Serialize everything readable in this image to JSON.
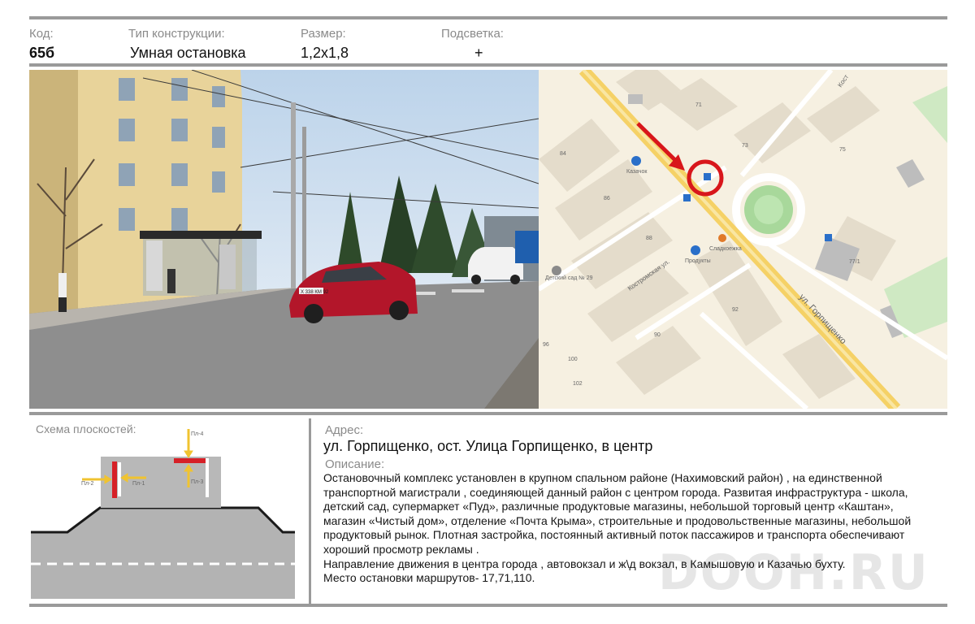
{
  "header": {
    "code_label": "Код:",
    "code_value": "65б",
    "type_label": "Тип конструкции:",
    "type_value": "Умная остановка",
    "size_label": "Размер:",
    "size_value": "1,2х1,8",
    "light_label": "Подсветка:",
    "light_value": "+"
  },
  "photo": {
    "plate": "Х 338 КМ 92"
  },
  "map": {
    "street_main": "ул. Горпищенко",
    "street_side": "Костромская ул.",
    "street_top": "Кост",
    "poi_kazachok": "Казачок",
    "poi_produkt": "Продукты",
    "poi_sladkoezhka": "Сладкоежка",
    "poi_kindergarten": "Детский сад № 29",
    "house_numbers": [
      "71",
      "73",
      "75",
      "84",
      "86",
      "88",
      "90",
      "92",
      "96",
      "100",
      "102",
      "77/1"
    ],
    "colors": {
      "marker": "#d8161b",
      "road": "#f5d166",
      "arrow": "#d8161b"
    }
  },
  "scheme": {
    "title": "Схема плоскостей:",
    "labels": [
      "Пл-1",
      "Пл-2",
      "Пл-3",
      "Пл-4"
    ]
  },
  "address": {
    "label": "Адрес:",
    "value": "ул. Горпищенко, ост. Улица Горпищенко, в центр"
  },
  "description": {
    "label": "Описание:",
    "lines": [
      "Остановочный комплекс установлен  в крупном спальном районе (Нахимовский район) , на единственной",
      "транспортной магистрали , соединяющей данный район с центром города. Развитая инфраструктура -  школа,",
      "детский сад,  супермаркет «Пуд», различные продуктовые магазины, небольшой торговый центр «Каштан»,",
      "магазин «Чистый дом», отделение «Почта Крыма», строительные и продовольственные магазины, небольшой",
      "продуктовый рынок.  Плотная застройка, постоянный активный поток пассажиров и транспорта обеспечивают",
      "хороший просмотр рекламы .",
      "Направление движения в центра города , автовокзал и ж\\д вокзал, в Камышовую и  Казачью бухту.",
      "Место остановки маршрутов- 17,71,110."
    ]
  },
  "watermark": "DOOH.RU"
}
